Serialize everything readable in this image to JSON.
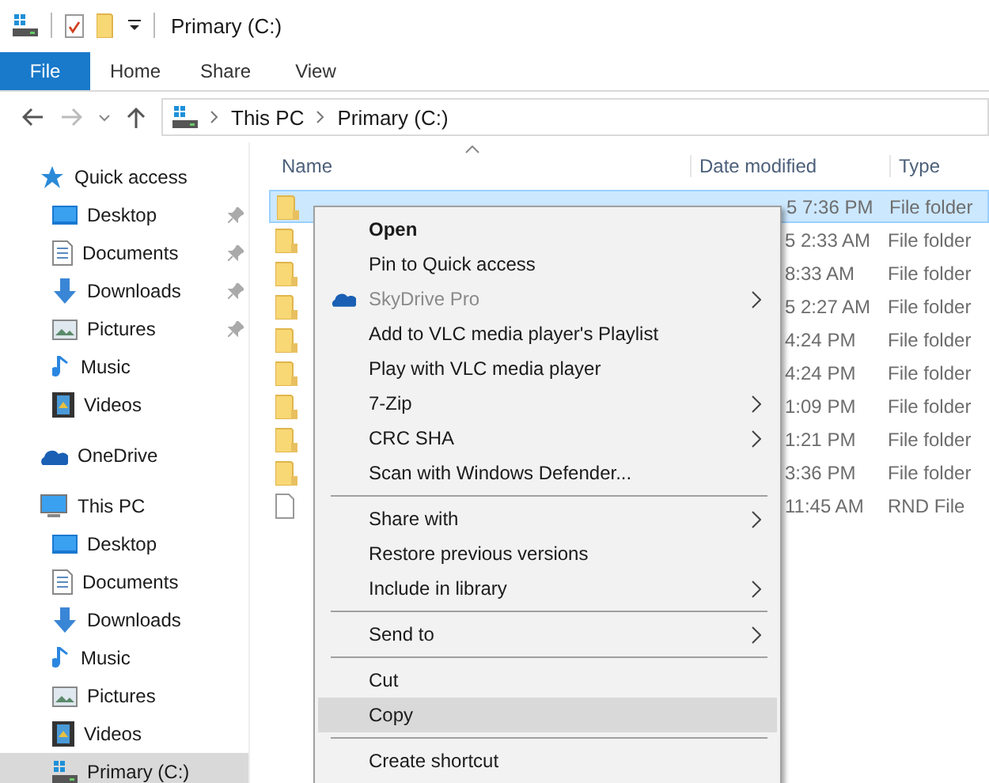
{
  "title_bar": {
    "title": "Primary (C:)"
  },
  "ribbon_tabs": [
    {
      "label": "File",
      "selected": true
    },
    {
      "label": "Home",
      "selected": false
    },
    {
      "label": "Share",
      "selected": false
    },
    {
      "label": "View",
      "selected": false
    }
  ],
  "address_bar": {
    "path": [
      "This PC",
      "Primary (C:)"
    ]
  },
  "nav": [
    {
      "label": "Quick access",
      "kind": "star",
      "selected": false,
      "children": [
        {
          "label": "Desktop",
          "kind": "desktop",
          "pinned": true,
          "selected": false
        },
        {
          "label": "Documents",
          "kind": "documents",
          "pinned": true,
          "selected": false
        },
        {
          "label": "Downloads",
          "kind": "downloads",
          "pinned": true,
          "selected": false
        },
        {
          "label": "Pictures",
          "kind": "pictures",
          "pinned": true,
          "selected": false
        },
        {
          "label": "Music",
          "kind": "music",
          "pinned": false,
          "selected": false
        },
        {
          "label": "Videos",
          "kind": "videos",
          "pinned": false,
          "selected": false
        }
      ]
    },
    {
      "label": "OneDrive",
      "kind": "cloud",
      "selected": false
    },
    {
      "label": "This PC",
      "kind": "pc",
      "selected": false,
      "children": [
        {
          "label": "Desktop",
          "kind": "desktop",
          "pinned": false,
          "selected": false
        },
        {
          "label": "Documents",
          "kind": "documents",
          "pinned": false,
          "selected": false
        },
        {
          "label": "Downloads",
          "kind": "downloads",
          "pinned": false,
          "selected": false
        },
        {
          "label": "Music",
          "kind": "music",
          "pinned": false,
          "selected": false
        },
        {
          "label": "Pictures",
          "kind": "pictures",
          "pinned": false,
          "selected": false
        },
        {
          "label": "Videos",
          "kind": "videos",
          "pinned": false,
          "selected": false
        },
        {
          "label": "Primary (C:)",
          "kind": "drive",
          "pinned": false,
          "selected": true
        }
      ]
    }
  ],
  "file_list": {
    "columns": [
      "Name",
      "Date modified",
      "Type"
    ],
    "rows": [
      {
        "kind": "folder",
        "date_modified": "5 7:36 PM",
        "type": "File folder",
        "selected": true
      },
      {
        "kind": "folder",
        "date_modified": "5 2:33 AM",
        "type": "File folder",
        "selected": false
      },
      {
        "kind": "folder",
        "date_modified": "8:33 AM",
        "type": "File folder",
        "selected": false
      },
      {
        "kind": "folder",
        "date_modified": "5 2:27 AM",
        "type": "File folder",
        "selected": false
      },
      {
        "kind": "folder",
        "date_modified": "4:24 PM",
        "type": "File folder",
        "selected": false
      },
      {
        "kind": "folder",
        "date_modified": "4:24 PM",
        "type": "File folder",
        "selected": false
      },
      {
        "kind": "folder",
        "date_modified": "1:09 PM",
        "type": "File folder",
        "selected": false
      },
      {
        "kind": "folder",
        "date_modified": "1:21 PM",
        "type": "File folder",
        "selected": false
      },
      {
        "kind": "folder",
        "date_modified": "3:36 PM",
        "type": "File folder",
        "selected": false
      },
      {
        "kind": "file",
        "date_modified": "11:45 AM",
        "type": "RND File",
        "selected": false
      }
    ]
  },
  "context_menu": [
    {
      "kind": "item",
      "label": "Open",
      "bold": true,
      "disabled": false,
      "submenu": false,
      "icon": false,
      "selected": false
    },
    {
      "kind": "item",
      "label": "Pin to Quick access",
      "bold": false,
      "disabled": false,
      "submenu": false,
      "icon": false,
      "selected": false
    },
    {
      "kind": "item",
      "label": "SkyDrive Pro",
      "bold": false,
      "disabled": true,
      "submenu": true,
      "icon": true,
      "selected": false
    },
    {
      "kind": "item",
      "label": "Add to VLC media player's Playlist",
      "bold": false,
      "disabled": false,
      "submenu": false,
      "icon": false,
      "selected": false
    },
    {
      "kind": "item",
      "label": "Play with VLC media player",
      "bold": false,
      "disabled": false,
      "submenu": false,
      "icon": false,
      "selected": false
    },
    {
      "kind": "item",
      "label": "7-Zip",
      "bold": false,
      "disabled": false,
      "submenu": true,
      "icon": false,
      "selected": false
    },
    {
      "kind": "item",
      "label": "CRC SHA",
      "bold": false,
      "disabled": false,
      "submenu": true,
      "icon": false,
      "selected": false
    },
    {
      "kind": "item",
      "label": "Scan with Windows Defender...",
      "bold": false,
      "disabled": false,
      "submenu": false,
      "icon": false,
      "selected": false
    },
    {
      "kind": "separator"
    },
    {
      "kind": "item",
      "label": "Share with",
      "bold": false,
      "disabled": false,
      "submenu": true,
      "icon": false,
      "selected": false
    },
    {
      "kind": "item",
      "label": "Restore previous versions",
      "bold": false,
      "disabled": false,
      "submenu": false,
      "icon": false,
      "selected": false
    },
    {
      "kind": "item",
      "label": "Include in library",
      "bold": false,
      "disabled": false,
      "submenu": true,
      "icon": false,
      "selected": false
    },
    {
      "kind": "separator"
    },
    {
      "kind": "item",
      "label": "Send to",
      "bold": false,
      "disabled": false,
      "submenu": true,
      "icon": false,
      "selected": false
    },
    {
      "kind": "separator"
    },
    {
      "kind": "item",
      "label": "Cut",
      "bold": false,
      "disabled": false,
      "submenu": false,
      "icon": false,
      "selected": false
    },
    {
      "kind": "item",
      "label": "Copy",
      "bold": false,
      "disabled": false,
      "submenu": false,
      "icon": false,
      "selected": true
    },
    {
      "kind": "separator"
    },
    {
      "kind": "item",
      "label": "Create shortcut",
      "bold": false,
      "disabled": false,
      "submenu": false,
      "icon": false,
      "selected": false
    }
  ]
}
